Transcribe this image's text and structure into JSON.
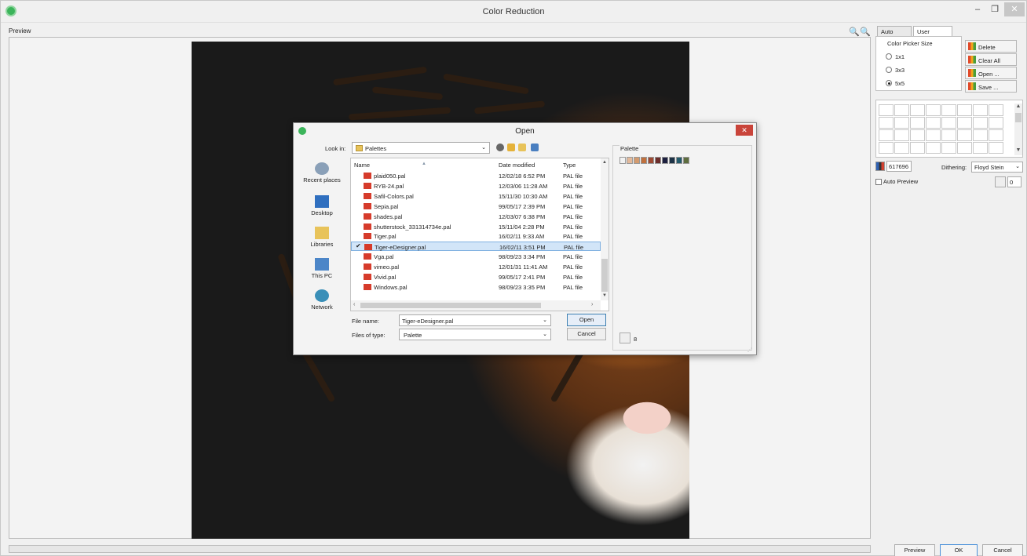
{
  "window": {
    "title": "Color Reduction",
    "minimize": "–",
    "maximize": "❐",
    "close": "✕"
  },
  "preview": {
    "label": "Preview",
    "zoom_in_glyph": "🔍",
    "zoom_out_glyph": "🔍"
  },
  "right_panel": {
    "tabs": [
      {
        "label": "Auto finding",
        "active": false
      },
      {
        "label": "User defined",
        "active": true
      }
    ],
    "picker_title": "Color Picker Size",
    "picker_options": [
      {
        "label": "1x1",
        "selected": false
      },
      {
        "label": "3x3",
        "selected": false
      },
      {
        "label": "5x5",
        "selected": true
      }
    ],
    "buttons": {
      "delete": "Delete",
      "clear_all": "Clear All",
      "open": "Open ...",
      "save": "Save ..."
    },
    "color_count": "617696",
    "dithering_label": "Dithering:",
    "dithering_value": "Floyd Stein",
    "auto_preview_label": "Auto Preview",
    "auto_preview_checked": false,
    "num_value": "0"
  },
  "bottom_buttons": {
    "preview": "Preview",
    "ok": "OK",
    "cancel": "Cancel"
  },
  "open_dialog": {
    "title": "Open",
    "close": "✕",
    "look_in_label": "Look in:",
    "look_in_value": "Palettes",
    "places": [
      "Recent places",
      "Desktop",
      "Libraries",
      "This PC",
      "Network"
    ],
    "columns": [
      "Name",
      "Date modified",
      "Type"
    ],
    "files": [
      {
        "name": "plaid050.pal",
        "date": "12/02/18 6:52 PM",
        "type": "PAL file",
        "selected": false
      },
      {
        "name": "RYB-24.pal",
        "date": "12/03/06 11:28 AM",
        "type": "PAL file",
        "selected": false
      },
      {
        "name": "Safil-Colors.pal",
        "date": "15/11/30 10:30 AM",
        "type": "PAL file",
        "selected": false
      },
      {
        "name": "Sepia.pal",
        "date": "99/05/17 2:39 PM",
        "type": "PAL file",
        "selected": false
      },
      {
        "name": "shades.pal",
        "date": "12/03/07 6:38 PM",
        "type": "PAL file",
        "selected": false
      },
      {
        "name": "shutterstock_331314734e.pal",
        "date": "15/11/04 2:28 PM",
        "type": "PAL file",
        "selected": false
      },
      {
        "name": "Tiger.pal",
        "date": "16/02/11 9:33 AM",
        "type": "PAL file",
        "selected": false
      },
      {
        "name": "Tiger-eDesigner.pal",
        "date": "16/02/11 3:51 PM",
        "type": "PAL file",
        "selected": true
      },
      {
        "name": "Vga.pal",
        "date": "98/09/23 3:34 PM",
        "type": "PAL file",
        "selected": false
      },
      {
        "name": "vimeo.pal",
        "date": "12/01/31 11:41 AM",
        "type": "PAL file",
        "selected": false
      },
      {
        "name": "Vivid.pal",
        "date": "99/05/17 2:41 PM",
        "type": "PAL file",
        "selected": false
      },
      {
        "name": "Windows.pal",
        "date": "98/09/23 3:35 PM",
        "type": "PAL file",
        "selected": false
      }
    ],
    "file_name_label": "File name:",
    "file_name_value": "Tiger-eDesigner.pal",
    "file_type_label": "Files of type:",
    "file_type_value": "Palette",
    "open_button": "Open",
    "cancel_button": "Cancel",
    "palette_title": "Palette",
    "palette_swatches": [
      "#f2f2f2",
      "#e3b99a",
      "#d39a6e",
      "#c0703d",
      "#9e4a33",
      "#6b2d2a",
      "#1c1f3e",
      "#1c3246",
      "#245a6b",
      "#5e6d3f"
    ],
    "palette_count": "8"
  }
}
